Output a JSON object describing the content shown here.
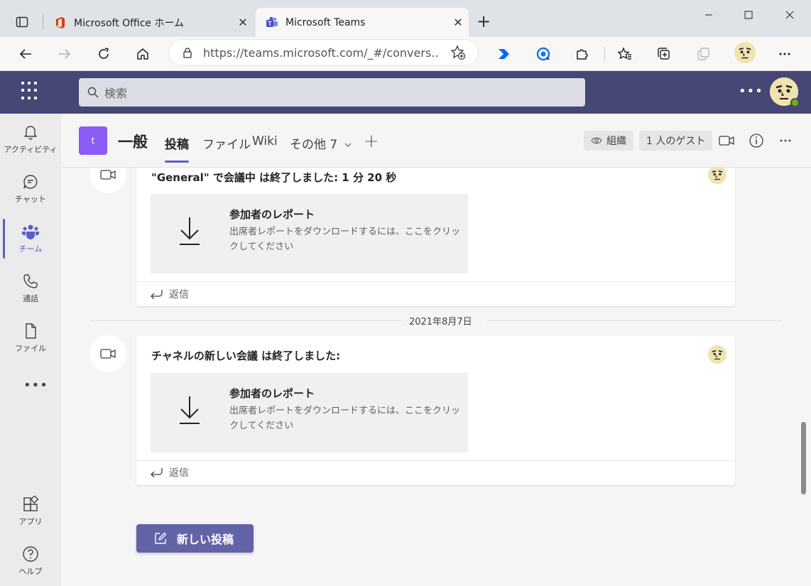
{
  "browser": {
    "tabs": [
      {
        "title": "Microsoft Office ホーム",
        "active": false
      },
      {
        "title": "Microsoft Teams",
        "active": true
      }
    ],
    "url": "https://teams.microsoft.com/_#/convers..."
  },
  "teams": {
    "search_placeholder": "検索",
    "rail": [
      {
        "label": "アクティビティ",
        "icon": "bell-icon"
      },
      {
        "label": "チャット",
        "icon": "chat-icon"
      },
      {
        "label": "チーム",
        "icon": "teams-icon",
        "active": true
      },
      {
        "label": "通話",
        "icon": "phone-icon"
      },
      {
        "label": "ファイル",
        "icon": "file-icon"
      },
      {
        "label": "アプリ",
        "icon": "apps-icon"
      },
      {
        "label": "ヘルプ",
        "icon": "help-icon"
      }
    ],
    "channel": {
      "avatar_letter": "t",
      "name": "一般",
      "tabs": [
        "投稿",
        "ファイル",
        "Wiki",
        "その他 7"
      ],
      "org_label": "組織",
      "guest_label": "1 人のゲスト"
    },
    "feed": {
      "posts": [
        {
          "message": "\"General\" で会議中 は終了しました: 1 分 20 秒",
          "report_title": "参加者のレポート",
          "report_desc": "出席者レポートをダウンロードするには、ここをクリックしてください",
          "reply_label": "返信"
        },
        {
          "message": "チャネルの新しい会議 は終了しました:",
          "report_title": "参加者のレポート",
          "report_desc": "出席者レポートをダウンロードするには、ここをクリックしてください",
          "reply_label": "返信"
        }
      ],
      "date_separator": "2021年8月7日"
    },
    "new_post_label": "新しい投稿",
    "colors": {
      "header": "#464775",
      "accent": "#5b5fc7",
      "button": "#6264a7",
      "channel_avatar": "#8b5cf6"
    }
  }
}
